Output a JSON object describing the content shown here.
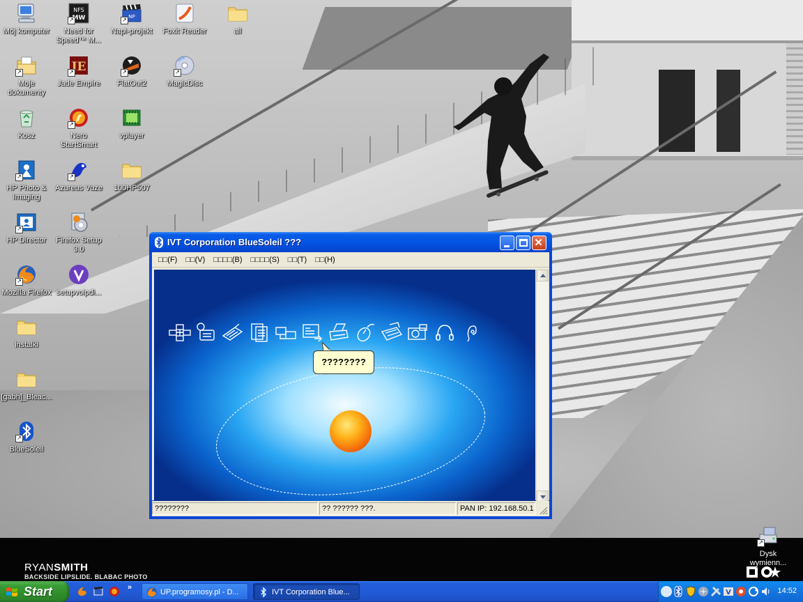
{
  "desktop": {
    "icons": [
      {
        "label": "Mój komputer"
      },
      {
        "label": "Moje dokumenty"
      },
      {
        "label": "Kosz"
      },
      {
        "label": "HP Photo & Imaging"
      },
      {
        "label": "HP Director"
      },
      {
        "label": "Mozilla Firefox"
      },
      {
        "label": "instalki"
      },
      {
        "label": "[gabh]_Bleac..."
      },
      {
        "label": "BlueSoleil"
      },
      {
        "label": "Need for Speed™ M..."
      },
      {
        "label": "Jade Empire"
      },
      {
        "label": "Nero StartSmart"
      },
      {
        "label": "Azureus Vuze"
      },
      {
        "label": "Firefox Setup 3.0"
      },
      {
        "label": "setupvoipdi..."
      },
      {
        "label": "Napi-projekt"
      },
      {
        "label": "FlatOut2"
      },
      {
        "label": "vplayer"
      },
      {
        "label": "100HP507"
      },
      {
        "label": "Foxit Reader"
      },
      {
        "label": "MagicDisc"
      },
      {
        "label": "all"
      },
      {
        "label": "Dysk wymienn..."
      }
    ],
    "wallpaper_caption": {
      "name_light": "RYAN",
      "name_bold": "SMITH",
      "subtitle": "BACKSIDE LIPSLIDE. BLABAC PHOTO"
    }
  },
  "window": {
    "title": "IVT Corporation BlueSoleil ???",
    "menu": [
      "□□(F)",
      "□□(V)",
      "□□□□(B)",
      "□□□□(S)",
      "□□(T)",
      "□□(H)"
    ],
    "service_icons": [
      "network-access-icon",
      "dialup-icon",
      "serial-port-icon",
      "file-transfer-icon",
      "sync-icon",
      "info-exchange-icon",
      "printer-icon",
      "mouse-icon",
      "fax-icon",
      "camera-icon",
      "headset-icon",
      "audio-icon"
    ],
    "balloon_text": "????????",
    "status": [
      "????????",
      "?? ?????? ???.",
      "PAN IP: 192.168.50.1"
    ],
    "colors": {
      "stage_center": "#f2fbff",
      "stage_edge": "#062f8c",
      "sun": "#f36a0a"
    }
  },
  "taskbar": {
    "start_label": "Start",
    "quicklaunch_more": "»",
    "tasks": [
      {
        "label": "UP.programosy.pl - D...",
        "active": false
      },
      {
        "label": "IVT Corporation Blue...",
        "active": true
      }
    ],
    "clock": "14:52"
  }
}
